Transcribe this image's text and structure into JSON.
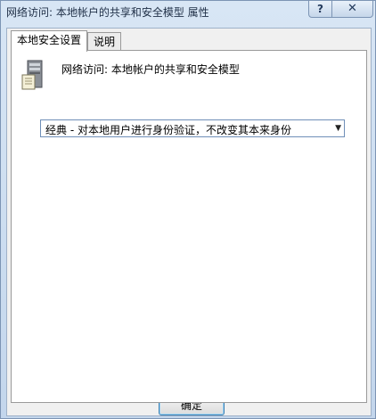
{
  "window": {
    "title": "网络访问: 本地帐户的共享和安全模型 属性",
    "help_label": "?",
    "close_label": "✕"
  },
  "tabs": [
    {
      "label": "本地安全设置",
      "active": true
    },
    {
      "label": "说明",
      "active": false
    }
  ],
  "policy": {
    "icon": "server-icon",
    "name": "网络访问: 本地帐户的共享和安全模型"
  },
  "dropdown": {
    "selected": "经典 - 对本地用户进行身份验证，不改变其本来身份",
    "arrow": "▼"
  },
  "buttons": {
    "ok_label": "确定"
  }
}
